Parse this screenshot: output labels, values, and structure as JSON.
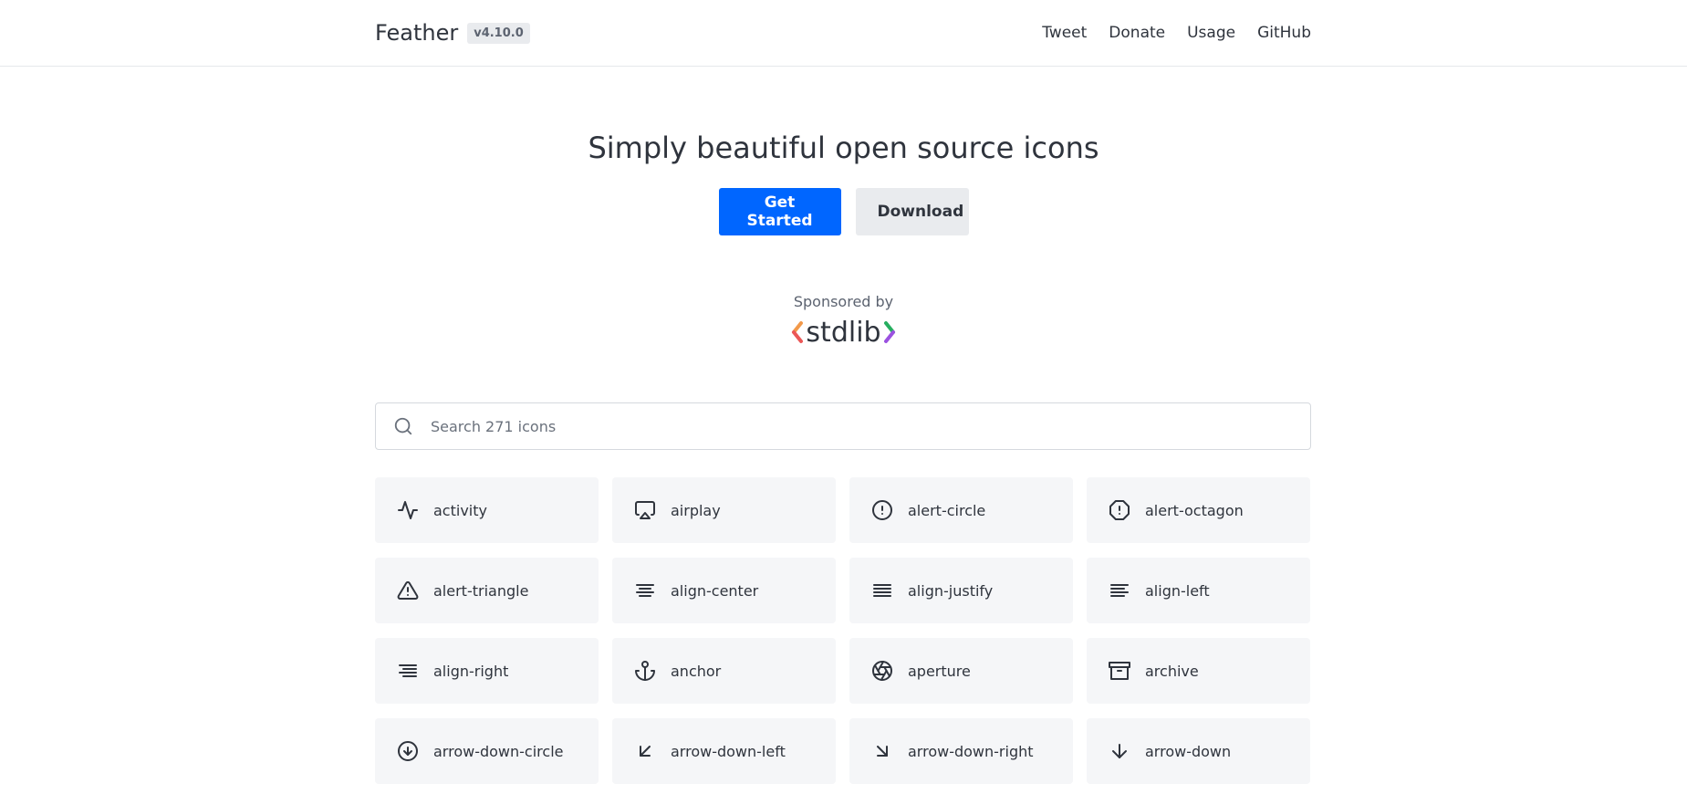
{
  "header": {
    "brand": "Feather",
    "version": "v4.10.0",
    "nav": [
      {
        "label": "Tweet"
      },
      {
        "label": "Donate"
      },
      {
        "label": "Usage"
      },
      {
        "label": "GitHub"
      }
    ]
  },
  "hero": {
    "title": "Simply beautiful open source icons",
    "primary_button": "Get Started",
    "secondary_button": "Download"
  },
  "sponsor": {
    "label": "Sponsored by",
    "logo_text": "stdlib"
  },
  "search": {
    "placeholder": "Search 271 icons",
    "value": ""
  },
  "icons": [
    {
      "name": "activity",
      "icon": "activity-icon"
    },
    {
      "name": "airplay",
      "icon": "airplay-icon"
    },
    {
      "name": "alert-circle",
      "icon": "alert-circle-icon"
    },
    {
      "name": "alert-octagon",
      "icon": "alert-octagon-icon"
    },
    {
      "name": "alert-triangle",
      "icon": "alert-triangle-icon"
    },
    {
      "name": "align-center",
      "icon": "align-center-icon"
    },
    {
      "name": "align-justify",
      "icon": "align-justify-icon"
    },
    {
      "name": "align-left",
      "icon": "align-left-icon"
    },
    {
      "name": "align-right",
      "icon": "align-right-icon"
    },
    {
      "name": "anchor",
      "icon": "anchor-icon"
    },
    {
      "name": "aperture",
      "icon": "aperture-icon"
    },
    {
      "name": "archive",
      "icon": "archive-icon"
    },
    {
      "name": "arrow-down-circle",
      "icon": "arrow-down-circle-icon"
    },
    {
      "name": "arrow-down-left",
      "icon": "arrow-down-left-icon"
    },
    {
      "name": "arrow-down-right",
      "icon": "arrow-down-right-icon"
    },
    {
      "name": "arrow-down",
      "icon": "arrow-down-icon"
    }
  ],
  "colors": {
    "primary": "#0066ff",
    "secondary_bg": "#e9ebee",
    "tile_bg": "#f5f6f8",
    "text": "#2f343d"
  }
}
